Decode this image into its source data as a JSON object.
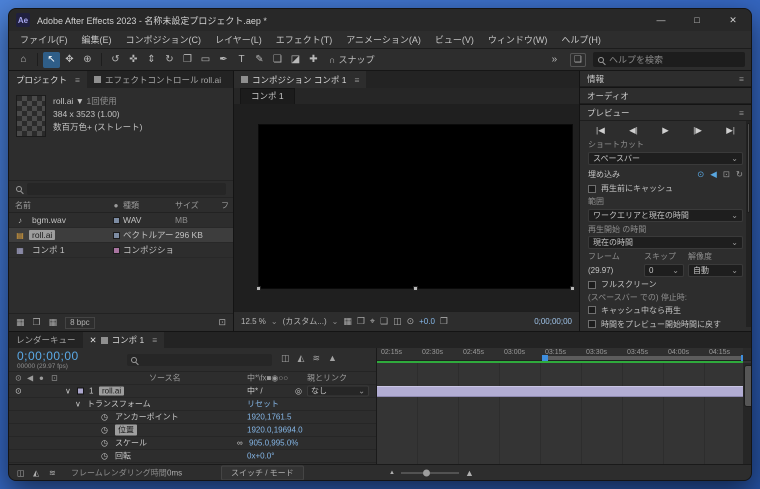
{
  "colors": {
    "accent_blue": "#3e8ede",
    "value_blue": "#85b7e8",
    "timecode_blue": "#5aa9e6",
    "selection_gray": "#9e9e9e",
    "layer_bar_lavender": "#b2add3",
    "rendered_frames_green": "#2faa3c",
    "desktop_blue": "#3566bf",
    "panel_gray": "#2d2d2d"
  },
  "icons": {
    "logo": "Ae",
    "minimize": "—",
    "maximize": "□",
    "close": "✕",
    "menu": "≡",
    "chevron": "⌄",
    "overflow": "»",
    "snap": "∩",
    "workspace": "❏",
    "eye": "⊙",
    "audio": "◀",
    "solo": "●",
    "lock": "⊡",
    "stopwatch": "◷",
    "pickwhip": "◎",
    "link": "∞",
    "twirl": "∨",
    "loop": "↻",
    "snapshot": "❐",
    "exposure": "⊙",
    "note": "♪",
    "footage": "▤",
    "comp": "▦",
    "tr_start": "|◀",
    "tr_back": "◀|",
    "tr_play": "▶",
    "tr_fwd": "|▶",
    "tr_end": "▶|",
    "grid": "▦",
    "roi": "❒",
    "target": "⌖",
    "view3d": "❑",
    "multiview": "◫",
    "mountain": "▲",
    "tab_close": "✕",
    "flowchart": "◫",
    "shy": "◭",
    "motion_blur": "≋"
  },
  "window": {
    "title": "Adobe After Effects 2023 - 名称未設定プロジェクト.aep *"
  },
  "menubar": {
    "items": [
      "ファイル(F)",
      "編集(E)",
      "コンポジション(C)",
      "レイヤー(L)",
      "エフェクト(T)",
      "アニメーション(A)",
      "ビュー(V)",
      "ウィンドウ(W)",
      "ヘルプ(H)"
    ]
  },
  "toolbar": {
    "snap_label": "スナップ",
    "search_placeholder": "ヘルプを検索",
    "tools": [
      {
        "glyph": "⌂"
      },
      {
        "glyph": "↖"
      },
      {
        "glyph": "✥"
      },
      {
        "glyph": "⊕"
      },
      {
        "glyph": "↺"
      },
      {
        "glyph": "✜"
      },
      {
        "glyph": "⇕"
      },
      {
        "glyph": "↻"
      },
      {
        "glyph": "❐"
      },
      {
        "glyph": "▭"
      },
      {
        "glyph": "✒"
      },
      {
        "glyph": "T"
      },
      {
        "glyph": "✎"
      },
      {
        "glyph": "❏"
      },
      {
        "glyph": "◪"
      },
      {
        "glyph": "✚"
      }
    ]
  },
  "project": {
    "tab_active": "プロジェクト",
    "tab_inactive": "エフェクトコントロール roll.ai",
    "info": {
      "name": "roll.ai ▼",
      "usage": "1回使用",
      "dimensions": "384 x 3523 (1.00)",
      "depth": "数百万色+ (ストレート)"
    },
    "columns": {
      "name": "名前",
      "type": "種類",
      "size": "サイズ",
      "fps": "フ"
    },
    "rows": [
      {
        "icon": "♪",
        "name": "bgm.wav",
        "type": "WAV",
        "size": "MB",
        "swatch": "background:#7d8ca3"
      },
      {
        "icon": "▤",
        "name": "roll.ai",
        "type": "ベクトルアート",
        "size": "296 KB",
        "swatch": "background:#7d8ca3"
      },
      {
        "icon": "▦",
        "name": "コンポ 1",
        "type": "コンポジション",
        "size": "",
        "swatch": "background:#a874a0"
      }
    ],
    "footer_depth": "8 bpc"
  },
  "comp": {
    "panel_tab": "コンポジション コンポ 1",
    "viewer_tab": "コンポ 1",
    "zoom": "12.5 %",
    "preset": "(カスタム...)",
    "exposure": "+0.0",
    "timecode": "0;00;00;00"
  },
  "rightbar": {
    "info": "情報",
    "audio": "オーディオ",
    "preview": "プレビュー",
    "shortcut_label": "ショートカット",
    "shortcut_value": "スペースバー",
    "include_label": "埋め込み",
    "cache_before": "再生前にキャッシュ",
    "range_label": "範囲",
    "range_value": "ワークエリアと現在の時間",
    "start_label": "再生開始 の時間",
    "start_value": "現在の時間",
    "frame_label": "フレーム",
    "skip_label": "スキップ",
    "res_label": "解像度",
    "frame_value": "(29.97)",
    "skip_value": "0",
    "res_value": "自動",
    "fullscreen": "フルスクリーン",
    "stop_label": "(スペースバー での) 停止時:",
    "stop_opt1": "キャッシュ中なら再生",
    "stop_opt2": "時間をプレビュー開始時間に戻す"
  },
  "timeline": {
    "tab_queue": "レンダーキュー",
    "tab_comp": "コンポ 1",
    "timecode": "0;00;00;00",
    "frame_info": "00000 (29.97 fps)",
    "head_source": "ソース名",
    "head_switches": "中*\\fx■◉○○",
    "head_parent": "親とリンク",
    "layer": {
      "index": "1",
      "name": "roll.ai",
      "switches": "中* /",
      "parent": "なし"
    },
    "group_label": "トランスフォーム",
    "reset": "リセット",
    "props": [
      {
        "label": "アンカーポイント",
        "value": "1920,1761.5"
      },
      {
        "label": "位置",
        "value": "1920.0,19694.0"
      },
      {
        "label": "スケール",
        "value": "905.0,995.0%"
      },
      {
        "label": "回転",
        "value": "0x+0.0°"
      }
    ],
    "ruler": [
      "02:15s",
      "02:30s",
      "02:45s",
      "03:00s",
      "03:15s",
      "03:30s",
      "03:45s",
      "04:00s",
      "04:15s"
    ],
    "footer": {
      "render_label": "フレームレンダリング時間",
      "render_value": "0ms",
      "switch_mode": "スイッチ / モード"
    }
  }
}
